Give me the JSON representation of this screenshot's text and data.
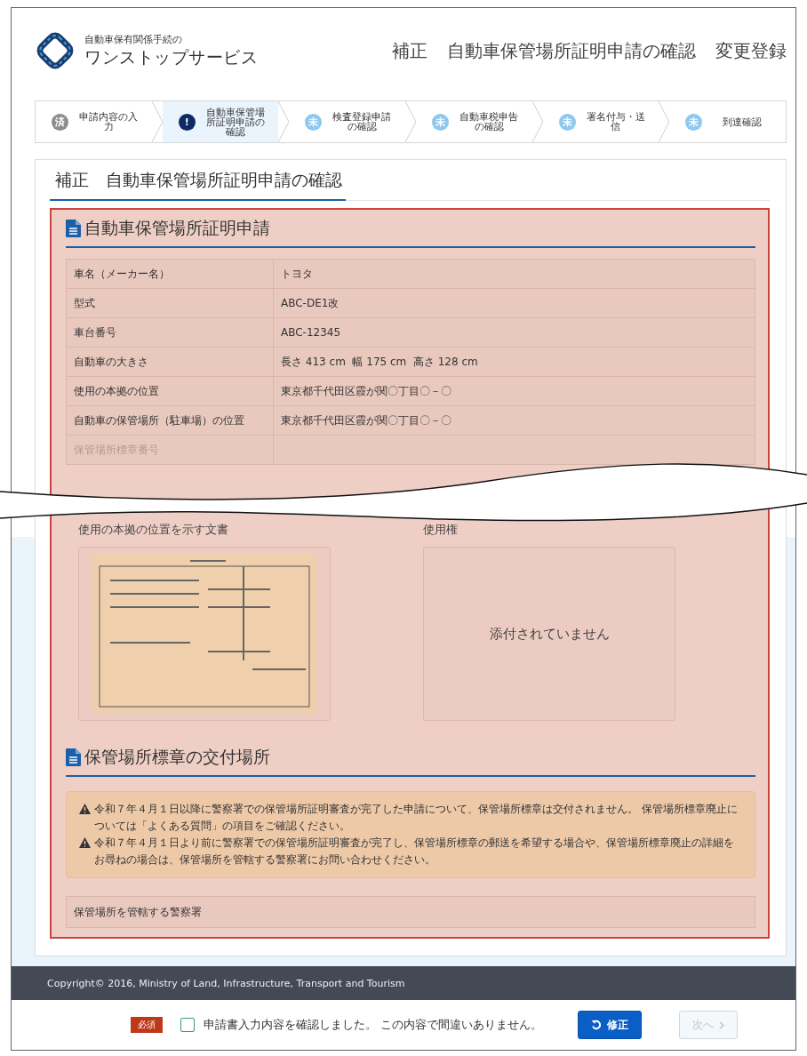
{
  "header": {
    "logo_subtitle": "自動車保有関係手続の",
    "logo_title": "ワンストップサービス",
    "title_parts": [
      "補正",
      "自動車保管場所証明申請の確認",
      "変更登録"
    ]
  },
  "steps": [
    {
      "badge": "済",
      "label": "申請内容の入力",
      "kind": "done",
      "selected": false
    },
    {
      "badge": "!",
      "label": "自動車保管場所証明申請の確認",
      "kind": "current",
      "selected": true
    },
    {
      "badge": "未",
      "label": "検査登録申請の確認",
      "kind": "todo",
      "selected": false
    },
    {
      "badge": "未",
      "label": "自動車税申告の確認",
      "kind": "todo",
      "selected": false
    },
    {
      "badge": "未",
      "label": "署名付与・送信",
      "kind": "todo",
      "selected": false
    },
    {
      "badge": "未",
      "label": "到達確認",
      "kind": "todo",
      "selected": false
    }
  ],
  "content": {
    "heading": "補正　自動車保管場所証明申請の確認",
    "highlighted": true
  },
  "section1": {
    "title": "自動車保管場所証明申請",
    "rows": [
      {
        "label": "車名（メーカー名）",
        "value": "トヨタ",
        "disabled": false
      },
      {
        "label": "型式",
        "value": "ABC-DE1改",
        "disabled": false
      },
      {
        "label": "車台番号",
        "value": "ABC-12345",
        "disabled": false
      },
      {
        "label": "自動車の大きさ",
        "value": "長さ 413 cm  幅 175 cm  高さ 128 cm",
        "disabled": false
      },
      {
        "label": "使用の本拠の位置",
        "value": "東京都千代田区霞が関〇丁目〇－〇",
        "disabled": false
      },
      {
        "label": "自動車の保管場所（駐車場）の位置",
        "value": "東京都千代田区霞が関〇丁目〇－〇",
        "disabled": false
      },
      {
        "label": "保管場所標章番号",
        "disabled": true
      }
    ]
  },
  "documents": [
    {
      "label": "使用の本拠の位置を示す文書",
      "kind": "image"
    },
    {
      "label": "使用権",
      "kind": "empty",
      "message": "添付されていません"
    }
  ],
  "section2": {
    "title": "保管場所標章の交付場所",
    "notices": [
      "令和７年４月１日以降に警察署での保管場所証明審査が完了した申請について、保管場所標章は交付されません。 保管場所標章廃止については「よくある質問」の項目をご確認ください。",
      "令和７年４月１日より前に警察署での保管場所証明審査が完了し、保管場所標章の郵送を希望する場合や、保管場所標章廃止の詳細をお尋ねの場合は、保管場所を管轄する警察署にお問い合わせください。"
    ],
    "field_label": "保管場所を管轄する警察署"
  },
  "footer": {
    "copyright": "Copyright© 2016, Ministry of Land, Infrastructure, Transport and Tourism"
  },
  "confirm": {
    "required": "必須",
    "checked": false,
    "text": "申請書入力内容を確認しました。 この内容で間違いありません。"
  },
  "buttons": [
    {
      "label": "修正",
      "kind": "revise",
      "disabled": false
    },
    {
      "label": "次へ",
      "kind": "next",
      "disabled": true
    }
  ]
}
